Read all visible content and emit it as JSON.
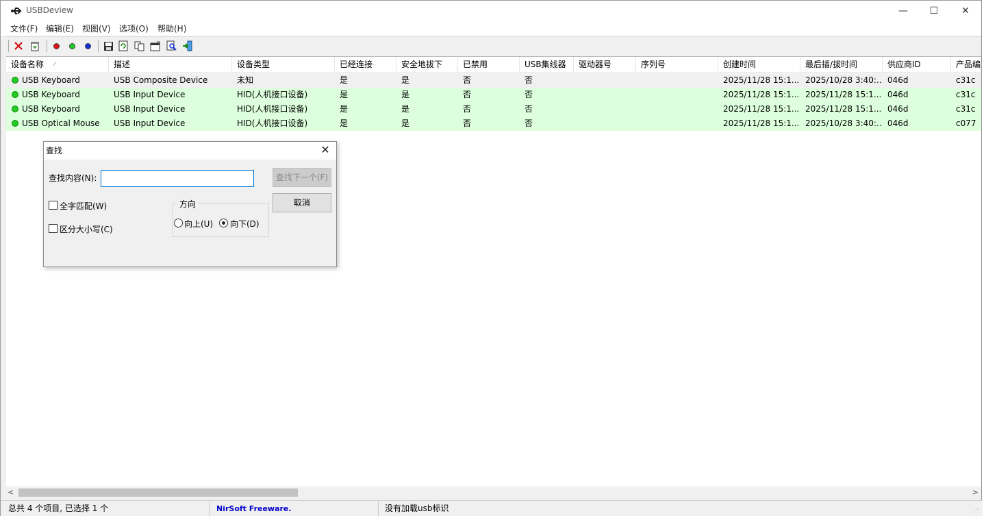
{
  "window": {
    "title": "USBDeview"
  },
  "window_controls": {
    "minimize": "—",
    "maximize": "☐",
    "close": "✕"
  },
  "menu": [
    "文件(F)",
    "编辑(E)",
    "视图(V)",
    "选项(O)",
    "帮助(H)"
  ],
  "toolbar": {
    "icons": [
      "delete-icon",
      "recycle-icon",
      "red-dot-icon",
      "green-dot-icon",
      "blue-dot-icon",
      "save-icon",
      "refresh-icon",
      "copy-icon",
      "properties-icon",
      "find-icon",
      "exit-icon"
    ],
    "colors": {
      "red": "#e81010",
      "green": "#22cc22",
      "blue": "#1030d0"
    }
  },
  "columns": [
    "设备名称",
    "描述",
    "设备类型",
    "已经连接",
    "安全地拔下",
    "已禁用",
    "USB集线器",
    "驱动器号",
    "序列号",
    "创建时间",
    "最后插/拔时间",
    "供应商ID",
    "产品编"
  ],
  "sort_indicator": "⁄",
  "rows": [
    [
      "USB Keyboard",
      "USB Composite Device",
      "未知",
      "是",
      "是",
      "否",
      "否",
      "",
      "",
      "2025/11/28 15:1...",
      "2025/10/28 3:40:...",
      "046d",
      "c31c"
    ],
    [
      "USB Keyboard",
      "USB Input Device",
      "HID(人机接口设备)",
      "是",
      "是",
      "否",
      "否",
      "",
      "",
      "2025/11/28 15:1...",
      "2025/11/28 15:1...",
      "046d",
      "c31c"
    ],
    [
      "USB Keyboard",
      "USB Input Device",
      "HID(人机接口设备)",
      "是",
      "是",
      "否",
      "否",
      "",
      "",
      "2025/11/28 15:1...",
      "2025/11/28 15:1...",
      "046d",
      "c31c"
    ],
    [
      "USB Optical Mouse",
      "USB Input Device",
      "HID(人机接口设备)",
      "是",
      "是",
      "否",
      "否",
      "",
      "",
      "2025/11/28 15:1...",
      "2025/10/28 3:40:...",
      "046d",
      "c077"
    ]
  ],
  "row_colors": {
    "selected": "#f0f0f0",
    "connected": "#ddffdd",
    "status_dot": "#22cc22"
  },
  "scrollbar": {
    "left": "<",
    "right": ">"
  },
  "statusbar": {
    "count": "总共 4 个项目, 已选择 1 个",
    "link": "NirSoft Freeware.  http://www.nirsoft.net",
    "message": "没有加载usb标识"
  },
  "find_dialog": {
    "title": "查找",
    "close": "✕",
    "find_label": "查找内容(N):",
    "find_value": "",
    "find_next": "查找下一个(F)",
    "cancel": "取消",
    "whole_word": "全字匹配(W)",
    "match_case": "区分大小写(C)",
    "direction_label": "方向",
    "up": "向上(U)",
    "down": "向下(D)"
  }
}
